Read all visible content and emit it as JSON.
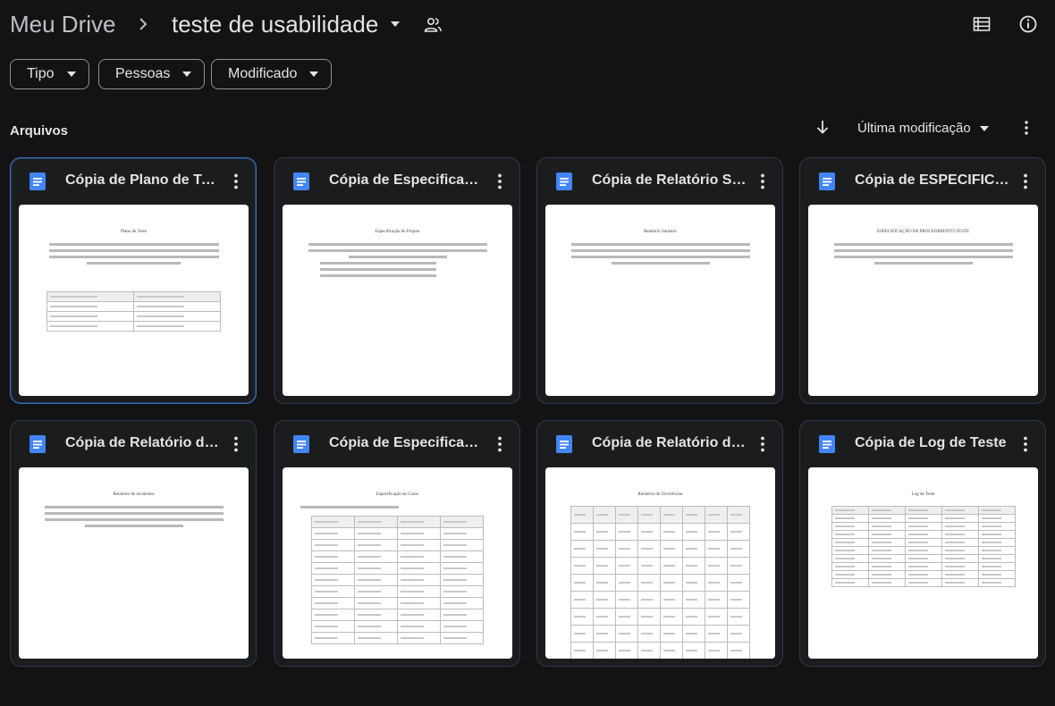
{
  "breadcrumb": {
    "root": "Meu Drive",
    "current": "teste de usabilidade"
  },
  "filters": [
    {
      "label": "Tipo"
    },
    {
      "label": "Pessoas"
    },
    {
      "label": "Modificado"
    }
  ],
  "section": {
    "title": "Arquivos",
    "sort_label": "Última modificação"
  },
  "colors": {
    "background": "#131314",
    "card_border": "#2a3b55",
    "selected_border": "#3d6fb5",
    "doc_icon": "#4285f4"
  },
  "files": [
    {
      "title": "Cópia de Plano de Teste",
      "selected": true,
      "thumb_heading": "Plano de Teste",
      "thumb_kind": "text-table"
    },
    {
      "title": "Cópia de Especificação do Projeto",
      "selected": false,
      "thumb_heading": "Especificação do Projeto",
      "thumb_kind": "text-list"
    },
    {
      "title": "Cópia de Relatório Sumário",
      "selected": false,
      "thumb_heading": "Relatório Sumário",
      "thumb_kind": "text"
    },
    {
      "title": "Cópia de ESPECIFICAÇÃO DE PROCEDIMENTO TESTE",
      "selected": false,
      "thumb_heading": "ESPECIFICAÇÃO DE PROCEDIMENTO TESTE",
      "thumb_kind": "text"
    },
    {
      "title": "Cópia de Relatório de Incidentes",
      "selected": false,
      "thumb_heading": "Relatório de incidentes",
      "thumb_kind": "text"
    },
    {
      "title": "Cópia de Especificação de Casos",
      "selected": false,
      "thumb_heading": "Especificação de Casos",
      "thumb_kind": "big-table"
    },
    {
      "title": "Cópia de Relatório de Ocorrências",
      "selected": false,
      "thumb_heading": "Relatório de Ocorrências",
      "thumb_kind": "grid-table"
    },
    {
      "title": "Cópia de Log de Teste",
      "selected": false,
      "thumb_heading": "Log de Teste",
      "thumb_kind": "log-table"
    }
  ]
}
